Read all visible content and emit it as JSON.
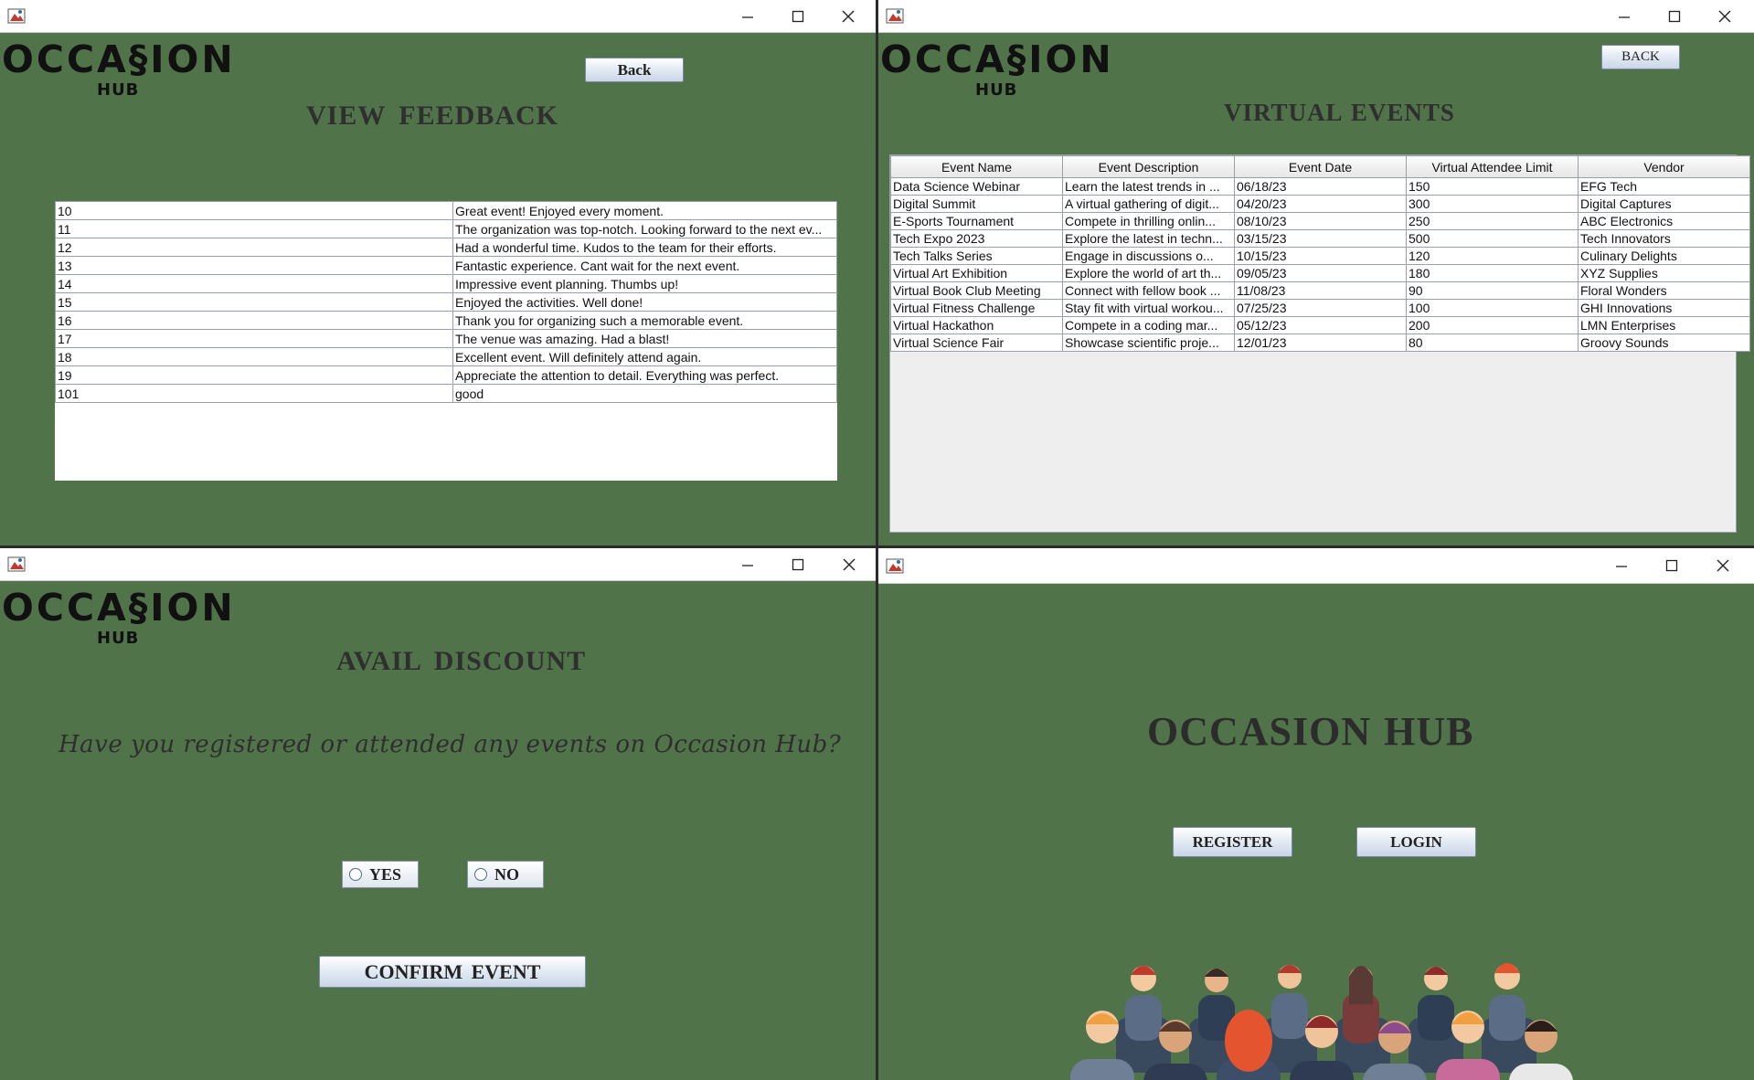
{
  "windows": {
    "feedback": {
      "logo": {
        "main": "OCCA§ION",
        "sub": "HUB"
      },
      "back_label": "Back",
      "heading": "VIEW  FEEDBACK",
      "rows": [
        {
          "id": "10",
          "text": "Great event! Enjoyed every moment."
        },
        {
          "id": "11",
          "text": "The organization was top-notch. Looking forward to the next ev..."
        },
        {
          "id": "12",
          "text": "Had a wonderful time. Kudos to the team for their efforts."
        },
        {
          "id": "13",
          "text": "Fantastic experience. Cant wait for the next event."
        },
        {
          "id": "14",
          "text": "Impressive event planning. Thumbs up!"
        },
        {
          "id": "15",
          "text": "Enjoyed the activities. Well done!"
        },
        {
          "id": "16",
          "text": "Thank you for organizing such a memorable event."
        },
        {
          "id": "17",
          "text": "The venue was amazing. Had a blast!"
        },
        {
          "id": "18",
          "text": "Excellent event. Will definitely attend again."
        },
        {
          "id": "19",
          "text": "Appreciate the attention to detail. Everything was perfect."
        },
        {
          "id": "101",
          "text": "good"
        }
      ]
    },
    "virtual": {
      "logo": {
        "main": "OCCA§ION",
        "sub": "HUB"
      },
      "back_label": "BACK",
      "heading": "VIRTUAL EVENTS",
      "columns": [
        "Event Name",
        "Event Description",
        "Event Date",
        "Virtual Attendee Limit",
        "Vendor"
      ],
      "rows": [
        [
          "Data Science Webinar",
          "Learn the latest trends in ...",
          "06/18/23",
          "150",
          "EFG Tech"
        ],
        [
          "Digital Summit",
          "A virtual gathering of digit...",
          "04/20/23",
          "300",
          "Digital Captures"
        ],
        [
          "E-Sports Tournament",
          "Compete in thrilling onlin...",
          "08/10/23",
          "250",
          "ABC Electronics"
        ],
        [
          "Tech Expo 2023",
          "Explore the latest in techn...",
          "03/15/23",
          "500",
          "Tech Innovators"
        ],
        [
          "Tech Talks Series",
          "Engage in discussions o...",
          "10/15/23",
          "120",
          "Culinary Delights"
        ],
        [
          "Virtual Art Exhibition",
          "Explore the world of art th...",
          "09/05/23",
          "180",
          "XYZ Supplies"
        ],
        [
          "Virtual Book Club Meeting",
          "Connect with fellow book ...",
          "11/08/23",
          "90",
          "Floral Wonders"
        ],
        [
          "Virtual Fitness Challenge",
          "Stay fit with virtual workou...",
          "07/25/23",
          "100",
          "GHI Innovations"
        ],
        [
          "Virtual Hackathon",
          "Compete in a coding mar...",
          "05/12/23",
          "200",
          "LMN Enterprises"
        ],
        [
          "Virtual Science Fair",
          "Showcase scientific proje...",
          "12/01/23",
          "80",
          "Groovy Sounds"
        ]
      ]
    },
    "discount": {
      "logo": {
        "main": "OCCA§ION",
        "sub": "HUB"
      },
      "heading": "AVAIL  DISCOUNT",
      "question": "Have you registered or attended any events on Occasion Hub?",
      "yes_label": "YES",
      "no_label": "NO",
      "confirm_label": "CONFIRM  EVENT"
    },
    "home": {
      "title": "OCCASION HUB",
      "register_label": "REGISTER",
      "login_label": "LOGIN"
    }
  },
  "colors": {
    "window_bg": "#517349",
    "titlebar": "#ffffff",
    "text_dark": "#2f2f2f"
  },
  "icons": [
    "java-app-icon",
    "minimize-icon",
    "maximize-icon",
    "close-icon",
    "audience-illustration"
  ]
}
